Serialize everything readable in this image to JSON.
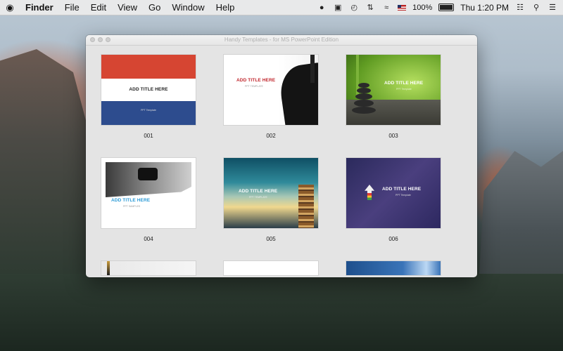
{
  "menubar": {
    "apple": "",
    "app_name": "Finder",
    "menus": [
      "File",
      "Edit",
      "View",
      "Go",
      "Window",
      "Help"
    ],
    "status": {
      "battery_percent": "100%",
      "clock": "Thu 1:20 PM"
    }
  },
  "window": {
    "title": "Handy Templates - for MS PowerPoint Edition",
    "templates": [
      {
        "number": "001",
        "title": "ADD TITLE HERE",
        "subtitle": "PPT Template"
      },
      {
        "number": "002",
        "title": "ADD TITLE HERE",
        "subtitle": "PPT TEMPLATE"
      },
      {
        "number": "003",
        "title": "ADD TITLE HERE",
        "subtitle": "PPT Template"
      },
      {
        "number": "004",
        "title": "ADD TITLE HERE",
        "subtitle": "PPT SAMPLES"
      },
      {
        "number": "005",
        "title": "ADD TITLE HERE",
        "subtitle": "PPT TEMPLATE"
      },
      {
        "number": "006",
        "title": "ADD TITLE HERE",
        "subtitle": "PPT Template"
      }
    ]
  },
  "colors": {
    "accent_red": "#d64532",
    "accent_blue": "#2d4c8e",
    "title_red": "#c0262c",
    "title_blue": "#2b9ad6"
  },
  "icons": [
    "apple-icon",
    "qq-icon",
    "cast-icon",
    "time-machine-icon",
    "sync-icon",
    "wifi-icon",
    "us-flag-icon",
    "battery-icon",
    "menu-extras-icon",
    "search-icon",
    "list-icon"
  ]
}
